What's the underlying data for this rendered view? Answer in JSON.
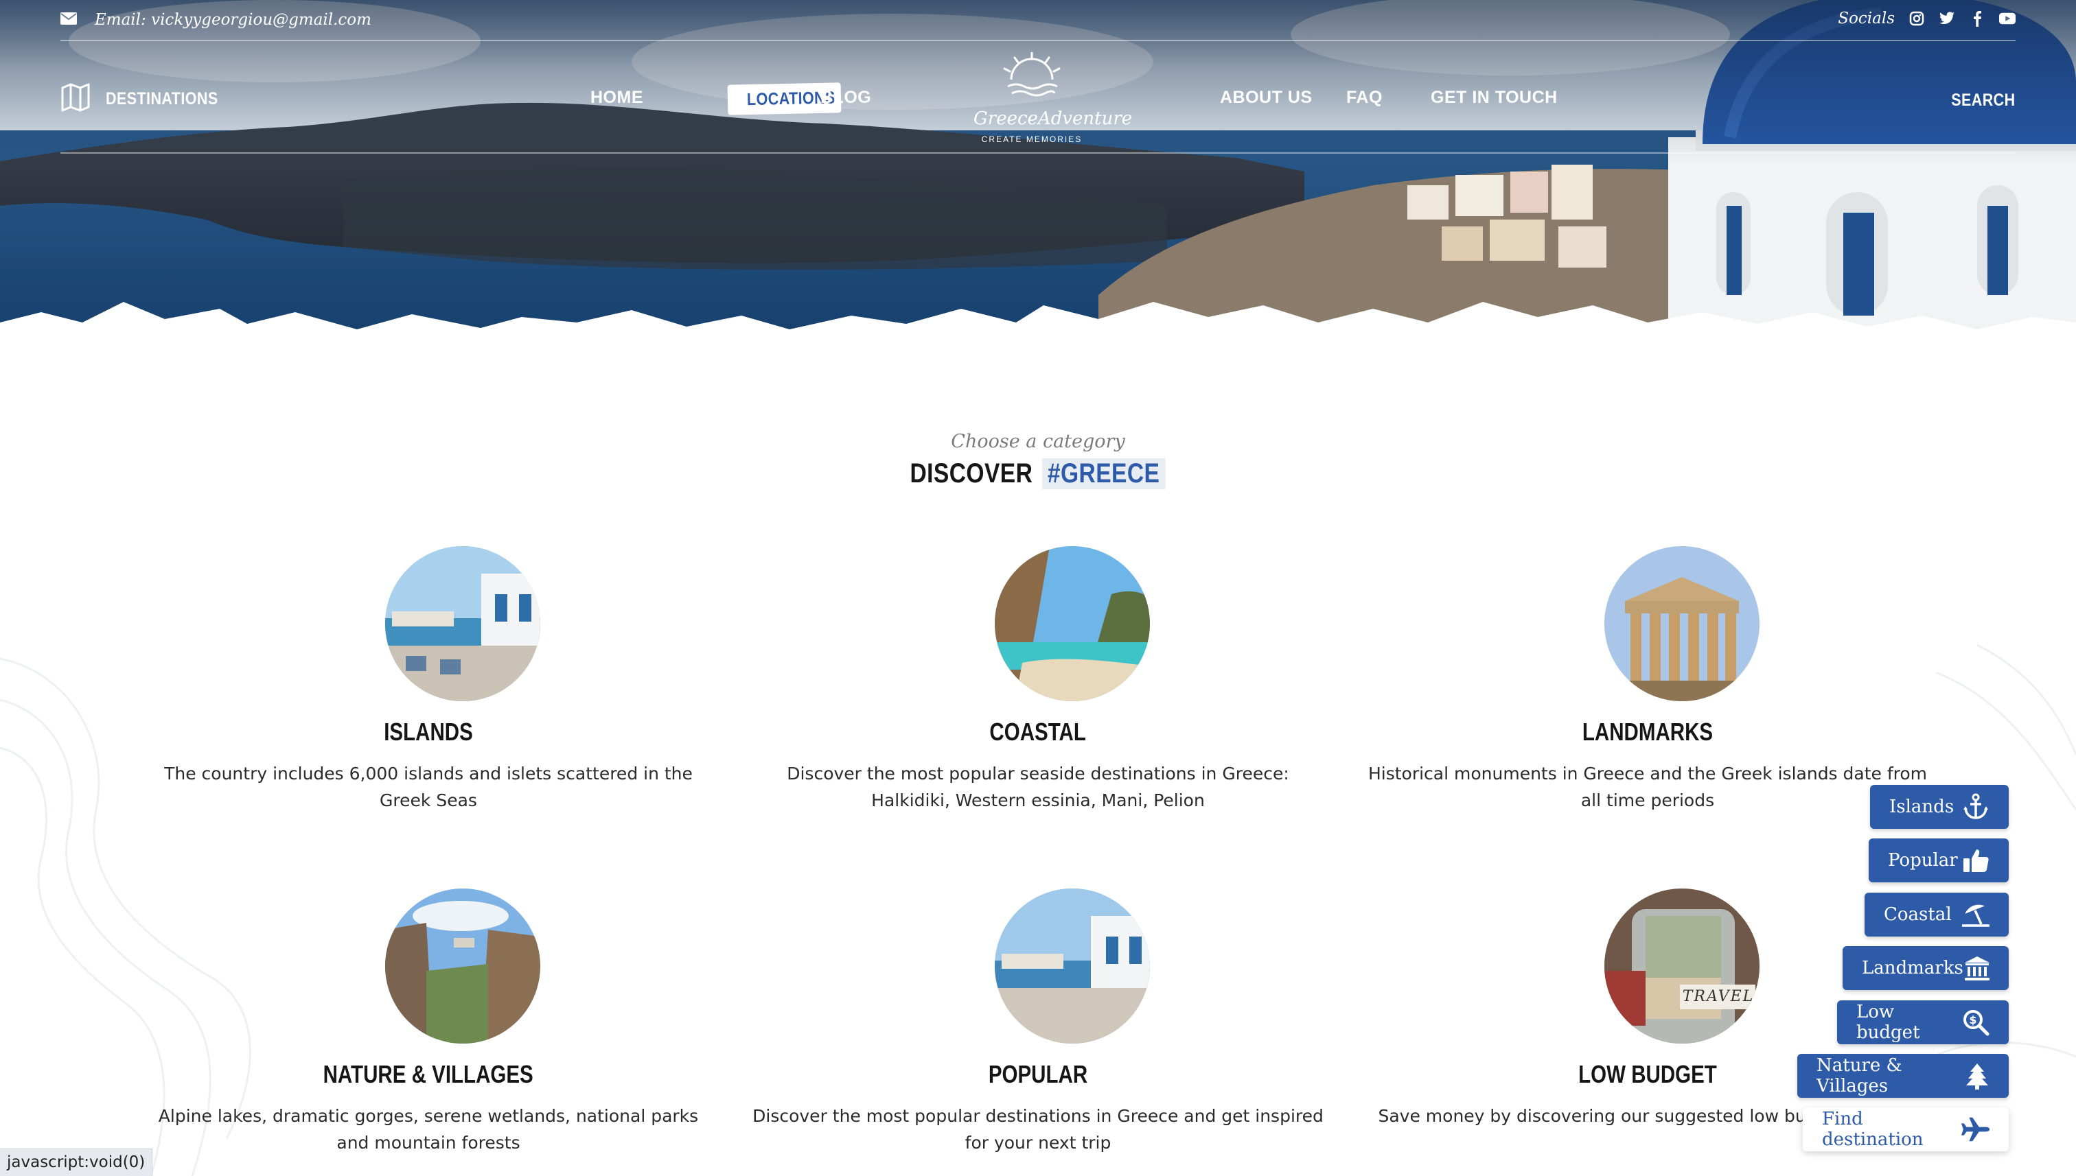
{
  "topbar": {
    "email": "Email: vickyygeorgiou@gmail.com",
    "socials_label": "Socials",
    "social_icons": [
      "instagram-icon",
      "twitter-icon",
      "facebook-icon",
      "youtube-icon"
    ]
  },
  "nav": {
    "destinations": "DESTINATIONS",
    "items": [
      {
        "label": "HOME"
      },
      {
        "label": "LOCATIONS",
        "active": true
      },
      {
        "label": "BLOG"
      },
      {
        "label": "ABOUT US"
      },
      {
        "label": "FAQ"
      },
      {
        "label": "GET IN TOUCH"
      }
    ],
    "search": "SEARCH"
  },
  "logo": {
    "brand": "GreeceAdventure",
    "tagline": "CREATE MEMORIES"
  },
  "discover": {
    "kicker": "Choose a category",
    "title": "DISCOVER",
    "hashtag": "#GREECE"
  },
  "categories": [
    {
      "title": "ISLANDS",
      "description": "The country includes 6,000 islands and islets scattered in the Greek Seas"
    },
    {
      "title": "COASTAL",
      "description": "Discover the most popular seaside destinations in Greece: Halkidiki, Western essinia, Mani, Pelion"
    },
    {
      "title": "LANDMARKS",
      "description": "Historical monuments in Greece and the Greek islands date from all time periods"
    },
    {
      "title": "NATURE & VILLAGES",
      "description": "Alpine lakes, dramatic gorges, serene wetlands, national parks and mountain forests"
    },
    {
      "title": "POPULAR",
      "description": "Discover the most popular destinations in Greece and get inspired for your next trip"
    },
    {
      "title": "LOW BUDGET",
      "description": "Save money by discovering our suggested low budget Greece."
    }
  ],
  "photo_labels": {
    "travel_jar": "TRAVEL"
  },
  "floating_buttons": [
    {
      "label": "Islands",
      "icon": "anchor-icon"
    },
    {
      "label": "Popular",
      "icon": "thumbs-up-icon"
    },
    {
      "label": "Coastal",
      "icon": "beach-umbrella-icon"
    },
    {
      "label": "Landmarks",
      "icon": "bank-icon"
    },
    {
      "label": "Low budget",
      "icon": "search-dollar-icon"
    },
    {
      "label": "Nature & Villages",
      "icon": "tree-icon"
    },
    {
      "label": "Find destination",
      "icon": "plane-icon"
    }
  ],
  "status_bar": "javascript:void(0)",
  "colors": {
    "brand": "#2e5ba8",
    "heading": "#161616",
    "muted": "#7a7a7a"
  }
}
